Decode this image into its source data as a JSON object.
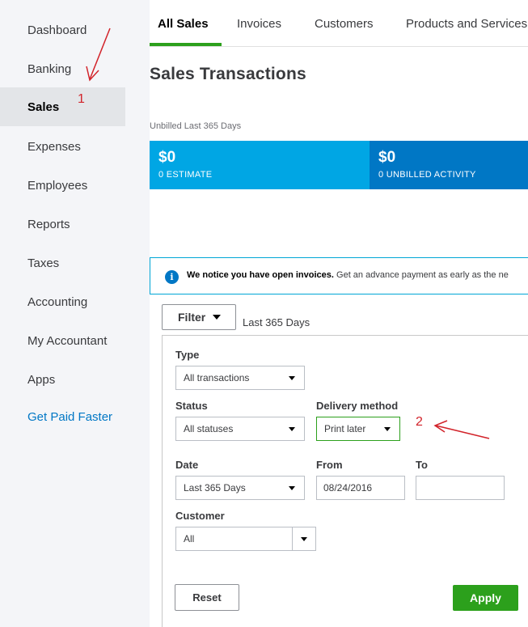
{
  "sidebar": {
    "items": [
      {
        "label": "Dashboard"
      },
      {
        "label": "Banking"
      },
      {
        "label": "Sales"
      },
      {
        "label": "Expenses"
      },
      {
        "label": "Employees"
      },
      {
        "label": "Reports"
      },
      {
        "label": "Taxes"
      },
      {
        "label": "Accounting"
      },
      {
        "label": "My Accountant"
      },
      {
        "label": "Apps"
      },
      {
        "label": "Get Paid Faster"
      }
    ],
    "active_index": 2
  },
  "tabs": [
    {
      "label": "All Sales"
    },
    {
      "label": "Invoices"
    },
    {
      "label": "Customers"
    },
    {
      "label": "Products and Services"
    }
  ],
  "page": {
    "title": "Sales Transactions",
    "unbilled_label": "Unbilled Last 365 Days"
  },
  "tiles": [
    {
      "amount": "$0",
      "caption": "0 ESTIMATE",
      "color": "#00a6e4"
    },
    {
      "amount": "$0",
      "caption": "0 UNBILLED ACTIVITY",
      "color": "#0077c5"
    }
  ],
  "notice": {
    "icon": "info-icon",
    "bold": "We notice you have open invoices.",
    "text": " Get an advance payment as early as the ne"
  },
  "filter": {
    "button_label": "Filter",
    "range_label": "Last 365 Days",
    "type": {
      "label": "Type",
      "value": "All transactions"
    },
    "status": {
      "label": "Status",
      "value": "All statuses"
    },
    "delivery": {
      "label": "Delivery method",
      "value": "Print later"
    },
    "date": {
      "label": "Date",
      "value": "Last 365 Days"
    },
    "from": {
      "label": "From",
      "value": "08/24/2016"
    },
    "to": {
      "label": "To",
      "value": ""
    },
    "customer": {
      "label": "Customer",
      "value": "All"
    },
    "reset_label": "Reset",
    "apply_label": "Apply"
  },
  "annotations": {
    "marker1": "1",
    "marker2": "2",
    "color": "#d2232a"
  },
  "colors": {
    "accent_green": "#2ca01c",
    "link_blue": "#0077c5"
  }
}
